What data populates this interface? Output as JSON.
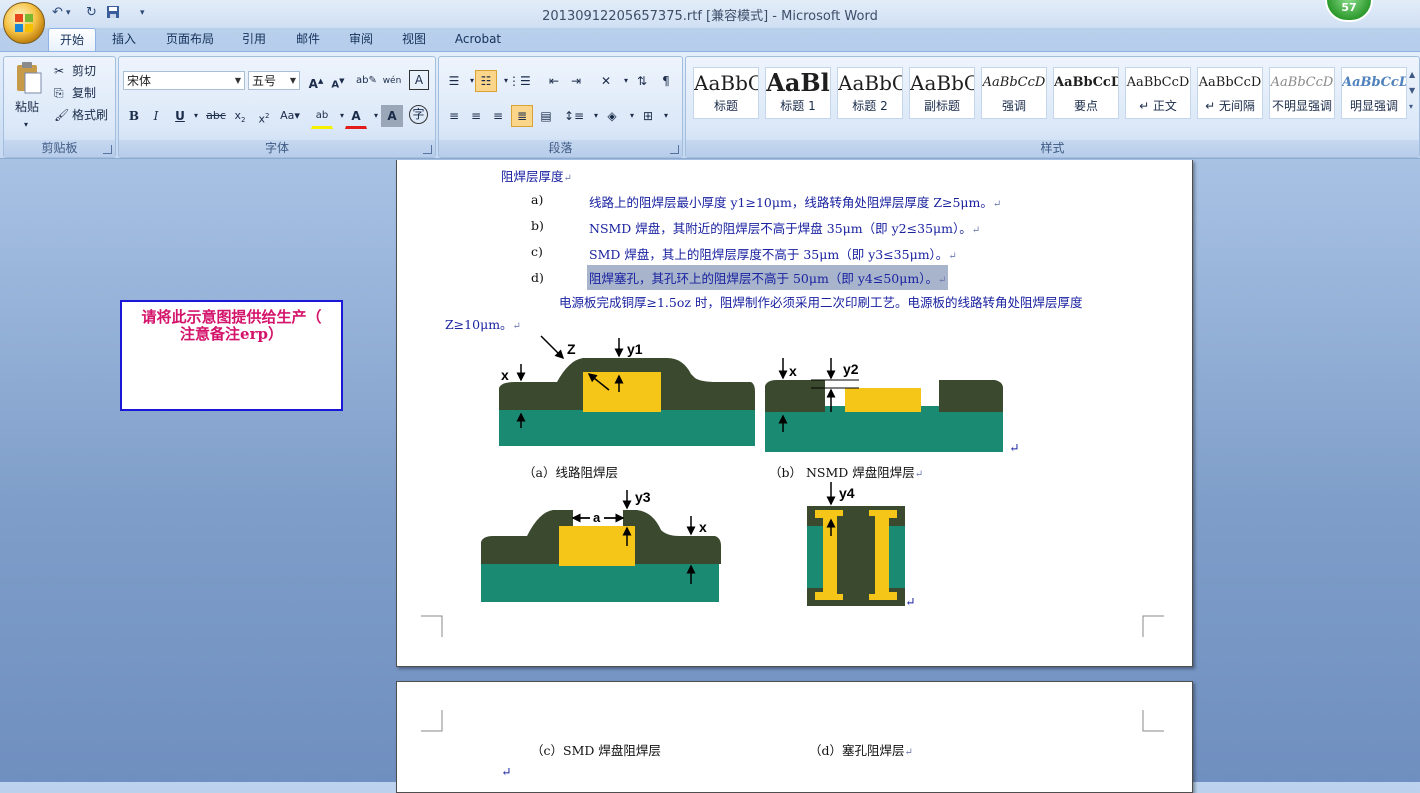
{
  "window": {
    "title": "20130912205657375.rtf [兼容模式] - Microsoft Word",
    "notification_count": "57"
  },
  "tabs": [
    "开始",
    "插入",
    "页面布局",
    "引用",
    "邮件",
    "审阅",
    "视图",
    "Acrobat"
  ],
  "ribbon": {
    "clipboard": {
      "label": "剪贴板",
      "paste": "粘贴",
      "cut": "剪切",
      "copy": "复制",
      "format_painter": "格式刷"
    },
    "font": {
      "label": "字体",
      "font_name": "宋体",
      "font_size": "五号"
    },
    "paragraph": {
      "label": "段落"
    },
    "styles": {
      "label": "样式",
      "items": [
        {
          "sample": "AaBbC",
          "name": "标题"
        },
        {
          "sample": "AaBl",
          "name": "标题 1"
        },
        {
          "sample": "AaBbC",
          "name": "标题 2"
        },
        {
          "sample": "AaBbC",
          "name": "副标题"
        },
        {
          "sample": "AaBbCcD",
          "name": "强调"
        },
        {
          "sample": "AaBbCcD",
          "name": "要点"
        },
        {
          "sample": "AaBbCcD",
          "name": "↵ 正文"
        },
        {
          "sample": "AaBbCcD",
          "name": "↵ 无间隔"
        },
        {
          "sample": "AaBbCcD",
          "name": "不明显强调"
        },
        {
          "sample": "AaBbCcD",
          "name": "明显强调"
        }
      ]
    }
  },
  "document": {
    "heading": "阻焊层厚度",
    "items": [
      {
        "marker": "a)",
        "text": "线路上的阻焊层最小厚度 y1≥10μm，线路转角处阻焊层厚度 Z≥5μm。"
      },
      {
        "marker": "b)",
        "text": "NSMD 焊盘，其附近的阻焊层不高于焊盘 35μm（即 y2≤35μm）。"
      },
      {
        "marker": "c)",
        "text": "SMD 焊盘，其上的阻焊层厚度不高于 35μm（即 y3≤35μm）。"
      },
      {
        "marker": "d)",
        "text": "阻焊塞孔，其孔环上的阻焊层不高于 50μm（即 y4≤50μm）。"
      }
    ],
    "para_line1": "电源板完成铜厚≥1.5oz 时，阻焊制作必须采用二次印刷工艺。电源板的线路转角处阻焊层厚度",
    "para_line2": "Z≥10μm。",
    "paragraph_mark": "↵",
    "captions": {
      "a": "（a）线路阻焊层",
      "b": "（b） NSMD 焊盘阻焊层",
      "c": "（c）SMD 焊盘阻焊层",
      "d": "（d）塞孔阻焊层"
    },
    "figure_labels": {
      "z": "Z",
      "y1": "y1",
      "x": "x",
      "y2": "y2",
      "y3": "y3",
      "a": "a",
      "y4": "y4"
    }
  },
  "callout": {
    "line1": "请将此示意图提供给生产（",
    "line2": "注意备注erp）"
  },
  "colors": {
    "solder_mask": "#3b4a2e",
    "substrate": "#1b8a72",
    "copper": "#f5c518",
    "callout_border": "#1b17d8",
    "callout_text": "#d4146b",
    "doc_text": "#1a22a0"
  }
}
